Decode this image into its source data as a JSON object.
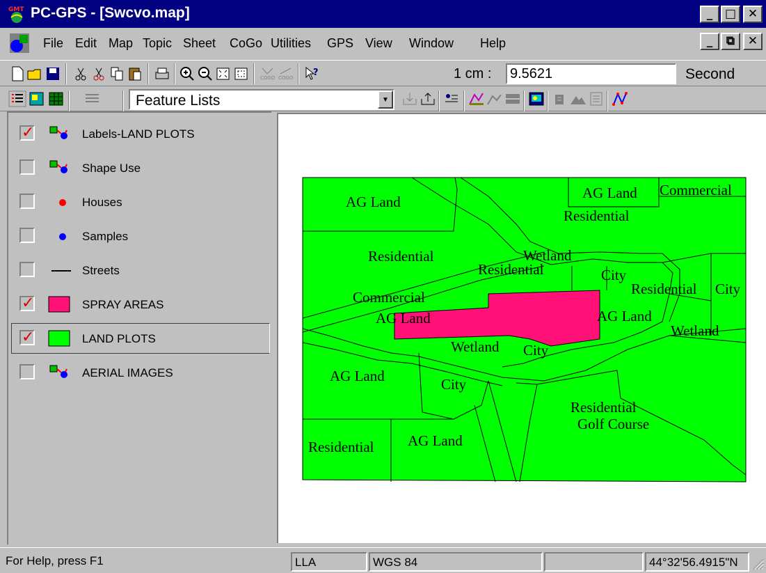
{
  "window": {
    "title": "PC-GPS - [Swcvo.map]",
    "minimize": "_",
    "maximize": "□",
    "close": "✕"
  },
  "menu": {
    "items": [
      "File",
      "Edit",
      "Map",
      "Topic",
      "Sheet",
      "CoGo",
      "Utilities",
      "GPS",
      "View",
      "Window",
      "Help"
    ],
    "mdi_minimize": "_",
    "mdi_restore": "⧉",
    "mdi_close": "✕"
  },
  "toolbar": {
    "scale_label": "1 cm :",
    "scale_value": "9.5621",
    "units": "Second"
  },
  "toolbar2": {
    "view_combo": "Feature Lists"
  },
  "layers": [
    {
      "label": "Labels-LAND PLOTS",
      "checked": true,
      "symbol": "label-icon"
    },
    {
      "label": "Shape Use",
      "checked": false,
      "symbol": "label-icon"
    },
    {
      "label": "Houses",
      "checked": false,
      "symbol": "red-dot",
      "color": "#ff0000"
    },
    {
      "label": "Samples",
      "checked": false,
      "symbol": "blue-dot",
      "color": "#0000ff"
    },
    {
      "label": "Streets",
      "checked": false,
      "symbol": "line"
    },
    {
      "label": "SPRAY AREAS",
      "checked": true,
      "symbol": "fill",
      "color": "#ff1177"
    },
    {
      "label": "LAND PLOTS",
      "checked": true,
      "symbol": "fill",
      "color": "#00ff00"
    },
    {
      "label": "AERIAL IMAGES",
      "checked": false,
      "symbol": "label-icon"
    }
  ],
  "check_mark": "✓",
  "map": {
    "land_color": "#00ff00",
    "spray_color": "#ff1177",
    "labels": [
      "AG Land",
      "AG Land",
      "Commercial",
      "Residential",
      "Residential",
      "Wetland",
      "Residential",
      "City",
      "Residential",
      "City",
      "Commercial",
      "AG Land",
      "AG Land",
      "Wetland",
      "Wetland",
      "City",
      "AG Land",
      "City",
      "Residential",
      "Golf Course",
      "Residential",
      "AG Land"
    ]
  },
  "status": {
    "help": "For Help, press F1",
    "projection": "LLA",
    "datum": "WGS 84",
    "empty": "",
    "coordinate": "44°32'56.4915\"N"
  }
}
